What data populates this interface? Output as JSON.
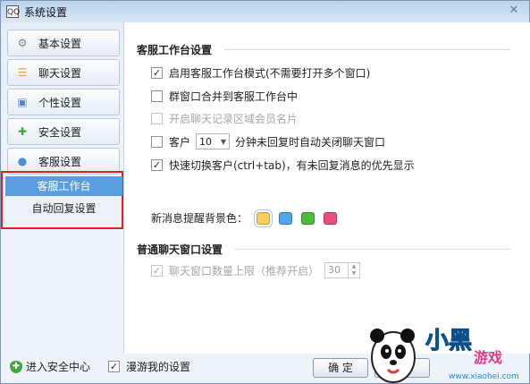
{
  "window": {
    "title": "系统设置",
    "app_icon": "QQ",
    "close_glyph": "✕"
  },
  "sidebar": {
    "items": [
      {
        "label": "基本设置",
        "icon": "gear-icon",
        "glyph": "⚙",
        "color": "#7b8a99"
      },
      {
        "label": "聊天设置",
        "icon": "chat-icon",
        "glyph": "☰",
        "color": "#e8a43a"
      },
      {
        "label": "个性设置",
        "icon": "window-icon",
        "glyph": "▣",
        "color": "#5a87c8"
      },
      {
        "label": "安全设置",
        "icon": "shield-icon",
        "glyph": "✚",
        "color": "#3aa83a"
      },
      {
        "label": "客服设置",
        "icon": "headset-icon",
        "glyph": "●",
        "color": "#4a8fd8"
      }
    ],
    "sub_items": [
      {
        "label": "客服工作台",
        "active": true
      },
      {
        "label": "自动回复设置",
        "active": false
      }
    ]
  },
  "main": {
    "section1_title": "客服工作台设置",
    "opt1": {
      "label": "启用客服工作台模式(不需要打开多个窗口)",
      "checked": true,
      "mark": "✓"
    },
    "opt2": {
      "label": "群窗口合并到客服工作台中",
      "checked": false
    },
    "opt3": {
      "label": "开启聊天记录区域会员名片",
      "checked": false,
      "disabled": true
    },
    "opt4": {
      "prefix": "客户",
      "select_value": "10",
      "select_arrow": "▼",
      "suffix": "分钟未回复时自动关闭聊天窗口",
      "checked": false
    },
    "opt5": {
      "label": "快速切换客户(ctrl+tab)，有未回复消息的优先显示",
      "checked": true,
      "mark": "✓"
    },
    "bg_label": "新消息提醒背景色：",
    "swatches": [
      "#f6cf5c",
      "#4fa6e8",
      "#4cbb3a",
      "#e84d7d"
    ],
    "section2_title": "普通聊天窗口设置",
    "opt6": {
      "label": "聊天窗口数量上限（推荐开启）",
      "checked": true,
      "disabled": true,
      "mark": "✓",
      "value": "30",
      "up": "▲",
      "down": "▼"
    }
  },
  "footer": {
    "security_center": "进入安全中心",
    "security_glyph": "✚",
    "roam_label": "漫游我的设置",
    "roam_mark": "✓",
    "ok": "确 定",
    "cancel": "消"
  },
  "watermark": {
    "brand": "小黑游戏",
    "url": "www.xiaohei.com"
  }
}
